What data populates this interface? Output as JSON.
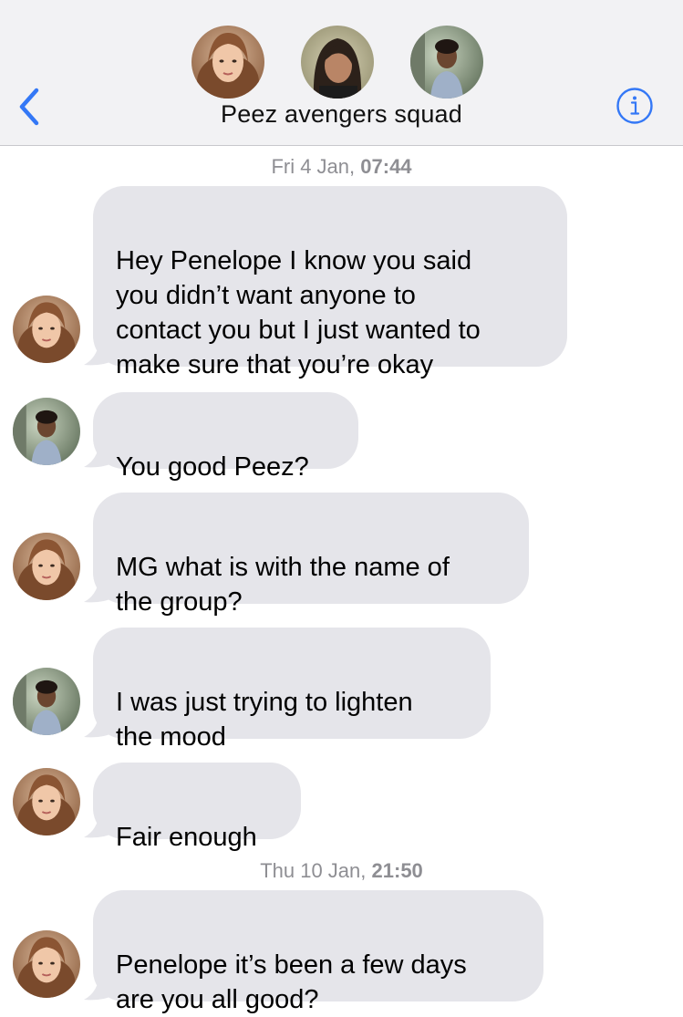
{
  "header": {
    "title": "Peez avengers squad",
    "back_icon": "chevron-left-icon",
    "info_icon": "info-icon",
    "accent_color": "#3478f6",
    "participants": [
      "avatar-penelope",
      "avatar-dark-hair",
      "avatar-mg"
    ]
  },
  "timestamps": [
    {
      "day": "Fri 4 Jan,",
      "time": "07:44"
    },
    {
      "day": "Thu 10 Jan,",
      "time": "21:50"
    }
  ],
  "messages": [
    {
      "text": "Hey Penelope I know you said\nyou didn’t want anyone to\ncontact you but I just wanted to\nmake sure that you’re okay",
      "sender": "penelope"
    },
    {
      "text": "You good Peez?",
      "sender": "mg"
    },
    {
      "text": "MG what is with the name of\nthe group?",
      "sender": "penelope"
    },
    {
      "text": "I was just trying to lighten\nthe mood",
      "sender": "mg"
    },
    {
      "text": "Fair enough",
      "sender": "penelope"
    },
    {
      "text": "Penelope it’s been a few days\nare you all good?",
      "sender": "penelope"
    }
  ],
  "colors": {
    "bubble": "#e5e5ea",
    "header_bg": "#f2f2f4",
    "timestamp": "#8e8e93"
  }
}
